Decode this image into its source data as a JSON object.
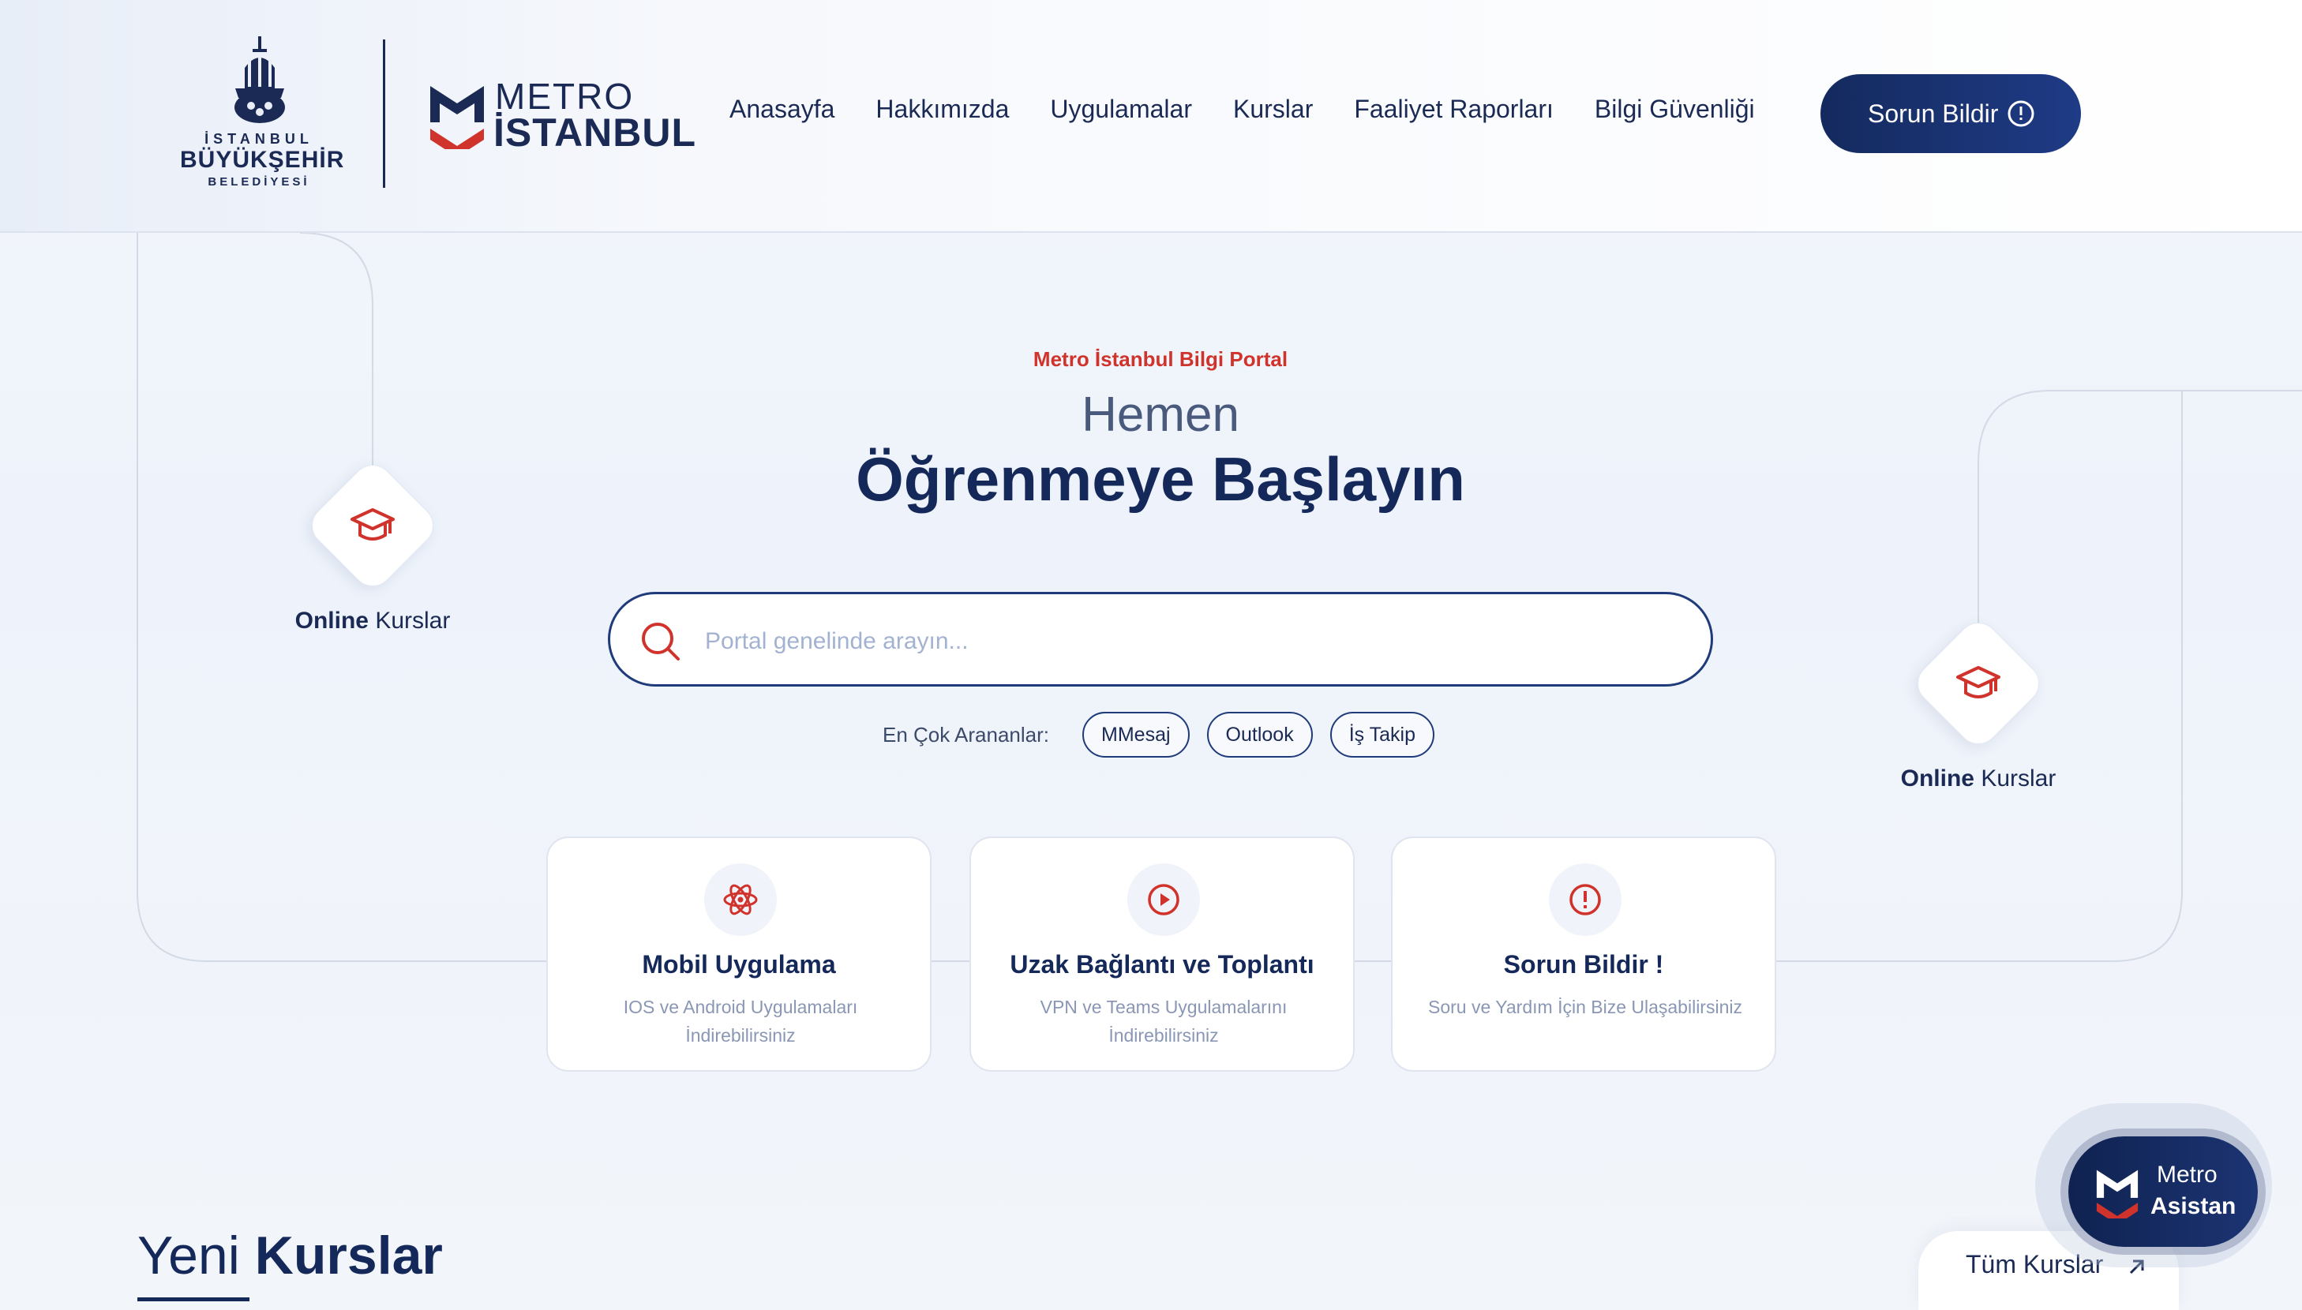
{
  "header": {
    "ibb_logo": {
      "line1": "İSTANBUL",
      "line2": "BÜYÜKŞEHİR",
      "line3": "BELEDİYESİ",
      "icon": "ibb-tulip-emblem-icon"
    },
    "metro_logo": {
      "line1": "METRO",
      "line2": "İSTANBUL",
      "icon": "metro-m-icon"
    },
    "nav": [
      {
        "label": "Anasayfa"
      },
      {
        "label": "Hakkımızda"
      },
      {
        "label": "Uygulamalar"
      },
      {
        "label": "Kurslar"
      },
      {
        "label": "Faaliyet Raporları"
      },
      {
        "label": "Bilgi Güvenliği"
      }
    ],
    "report_button": {
      "label": "Sorun Bildir",
      "icon": "alert-circle-icon"
    }
  },
  "hero": {
    "eyebrow": "Metro İstanbul Bilgi Portal",
    "title_light": "Hemen",
    "title_bold": "Öğrenmeye Başlayın"
  },
  "search": {
    "placeholder": "Portal genelinde arayın...",
    "value": "",
    "icon": "search-icon"
  },
  "popular": {
    "label": "En Çok Arananlar:",
    "chips": [
      "MMesaj",
      "Outlook",
      "İş Takip"
    ]
  },
  "side_badges": [
    {
      "bold": "Online",
      "rest": " Kurslar",
      "icon": "graduation-cap-icon"
    },
    {
      "bold": "Online",
      "rest": " Kurslar",
      "icon": "graduation-cap-icon"
    }
  ],
  "cards": [
    {
      "title": "Mobil Uygulama",
      "desc": "IOS ve Android Uygulamaları İndirebilirsiniz",
      "icon": "atom-icon"
    },
    {
      "title": "Uzak Bağlantı ve Toplantı",
      "desc": "VPN ve Teams Uygulamalarını İndirebilirsiniz",
      "icon": "play-circle-icon"
    },
    {
      "title": "Sorun Bildir !",
      "desc": "Soru ve Yardım İçin Bize Ulaşabilirsiniz",
      "icon": "alert-circle-icon"
    }
  ],
  "section": {
    "title_light": "Yeni",
    "title_bold": "Kurslar"
  },
  "all_courses": {
    "label": "Tüm Kurslar",
    "icon": "arrow-up-right-icon"
  },
  "assistant": {
    "line1": "Metro",
    "line2": "Asistan",
    "icon": "metro-m-icon"
  },
  "colors": {
    "navy": "#14285a",
    "accent_red": "#d0332b",
    "muted": "#8a97b4"
  }
}
